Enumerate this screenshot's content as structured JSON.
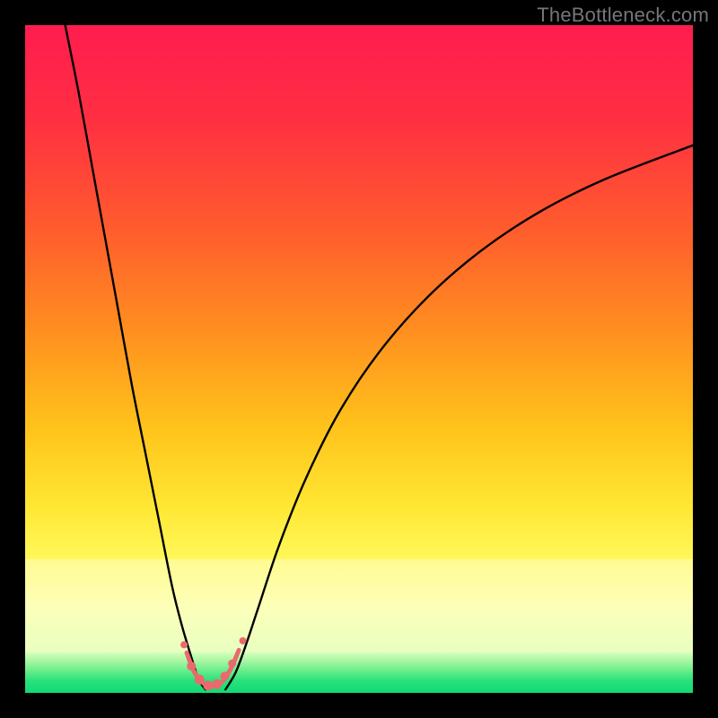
{
  "watermark": "TheBottleneck.com",
  "colors": {
    "frame": "#000000",
    "gradient_stops": [
      {
        "pct": 0,
        "color": "#ff1c4f"
      },
      {
        "pct": 14,
        "color": "#ff2f42"
      },
      {
        "pct": 30,
        "color": "#ff5a2e"
      },
      {
        "pct": 45,
        "color": "#ff8c20"
      },
      {
        "pct": 60,
        "color": "#ffc21b"
      },
      {
        "pct": 72,
        "color": "#ffe733"
      },
      {
        "pct": 80,
        "color": "#fff85a"
      },
      {
        "pct": 86,
        "color": "#f3ff7e"
      },
      {
        "pct": 100,
        "color": "#f3ff7e"
      }
    ],
    "bright_band": {
      "top_pct": 80.0,
      "height_pct": 14.0,
      "gradient": [
        {
          "pct": 0,
          "color": "#fffb90"
        },
        {
          "pct": 50,
          "color": "#fdffb8"
        },
        {
          "pct": 100,
          "color": "#e8ffc0"
        }
      ]
    },
    "green_strip": {
      "top_pct": 94.0,
      "height_pct": 6.0,
      "gradient": [
        {
          "pct": 0,
          "color": "#d4ffbb"
        },
        {
          "pct": 20,
          "color": "#a9f7a3"
        },
        {
          "pct": 45,
          "color": "#69ed8b"
        },
        {
          "pct": 70,
          "color": "#29e17b"
        },
        {
          "pct": 100,
          "color": "#11db75"
        }
      ]
    },
    "curve": "#000000",
    "dot": "#e96a6d"
  },
  "chart_data": {
    "type": "line",
    "title": "",
    "xlabel": "",
    "ylabel": "",
    "xlim": [
      0,
      100
    ],
    "ylim": [
      0,
      100
    ],
    "notch_x": 27,
    "series": [
      {
        "name": "left-branch",
        "x": [
          6,
          8,
          10,
          12,
          14,
          16,
          18,
          20,
          22,
          23.5,
          25,
          26,
          27
        ],
        "y": [
          100,
          90,
          79,
          68,
          57,
          46,
          36,
          26,
          16,
          10,
          5,
          2,
          0.5
        ]
      },
      {
        "name": "right-branch",
        "x": [
          30,
          31.5,
          33,
          35,
          38,
          42,
          47,
          53,
          60,
          68,
          77,
          87,
          100
        ],
        "y": [
          0.5,
          3,
          7,
          13,
          22,
          32,
          42,
          51,
          59,
          66,
          72,
          77,
          82
        ]
      },
      {
        "name": "valley-floor",
        "x": [
          24.2,
          25.2,
          26.3,
          27.4,
          28.5,
          29.6,
          30.2,
          31.0,
          32.0
        ],
        "y": [
          6.0,
          3.4,
          1.8,
          1.1,
          1.1,
          1.8,
          2.6,
          4.0,
          6.4
        ]
      }
    ],
    "markers": [
      {
        "x": 23.8,
        "y": 7.2,
        "r": 4.0
      },
      {
        "x": 24.9,
        "y": 4.0,
        "r": 5.0
      },
      {
        "x": 26.1,
        "y": 2.0,
        "r": 5.5
      },
      {
        "x": 27.4,
        "y": 1.1,
        "r": 5.5
      },
      {
        "x": 28.7,
        "y": 1.3,
        "r": 5.5
      },
      {
        "x": 29.9,
        "y": 2.5,
        "r": 5.0
      },
      {
        "x": 31.0,
        "y": 4.4,
        "r": 4.5
      },
      {
        "x": 32.6,
        "y": 7.8,
        "r": 4.0
      }
    ]
  }
}
